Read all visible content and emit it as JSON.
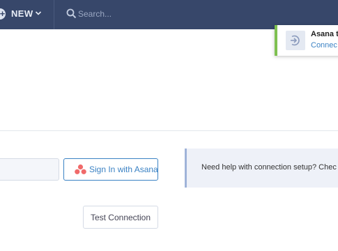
{
  "topbar": {
    "new_label": "NEW",
    "search_placeholder": "Search..."
  },
  "toast": {
    "title": "Asana t",
    "subtitle": "Connec"
  },
  "form": {
    "signin_label": "Sign In with Asana",
    "help_text": "Need help with connection setup? Chec",
    "test_label": "Test Connection"
  },
  "colors": {
    "topbar": "#37476a",
    "accent": "#3b82c4",
    "toast_border": "#7ec050",
    "help_border": "#9fb3d9",
    "asana_logo": "#f06a6a"
  },
  "icons": {
    "new": "plus-circle-icon",
    "new_menu": "chevron-down-icon",
    "search": "search-icon",
    "toast": "connection-icon",
    "signin": "asana-logo-icon"
  }
}
